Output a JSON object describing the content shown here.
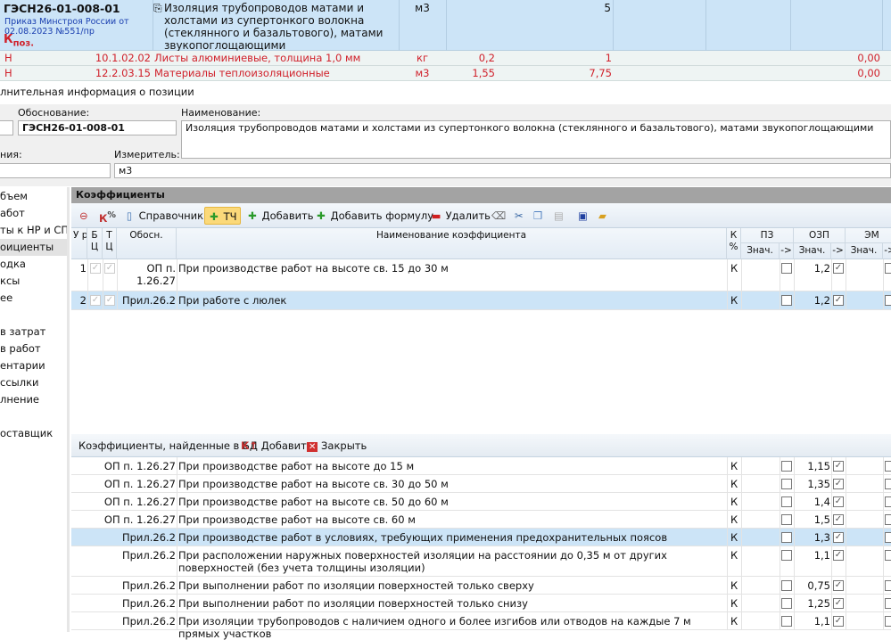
{
  "position": {
    "code": "ГЭСН26-01-008-01",
    "order": "Приказ Минстроя России от 02.08.2023 №551/пр",
    "kpoz_main": "К",
    "kpoz_sub": "поз.",
    "name": "Изоляция трубопроводов матами и холстами из супертонкого волокна (стеклянного и базальтового), матами звукопоглощающими",
    "unit": "м3",
    "qty": "5"
  },
  "resources": [
    {
      "type": "Н",
      "code": "10.1.02.02",
      "name": "Листы алюминиевые, толщина 1,0 мм",
      "unit": "кг",
      "norm": "0,2",
      "qty": "1",
      "sum": "0,00"
    },
    {
      "type": "Н",
      "code": "12.2.03.15",
      "name": "Материалы теплоизоляционные",
      "unit": "м3",
      "norm": "1,55",
      "qty": "7,75",
      "sum": "0,00"
    }
  ],
  "info_title": "лнительная информация о позиции",
  "form": {
    "basis_label": "Обоснование:",
    "basis_value": "ГЭСН26-01-008-01",
    "name_label": "Наименование:",
    "name_value": "Изоляция трубопроводов матами и холстами из супертонкого волокна (стеклянного и базальтового), матами звукопоглощающими",
    "left_label": "ния:",
    "unit_label": "Измеритель:",
    "unit_value": "м3"
  },
  "sidebar": [
    "бъем",
    "абот",
    "ты к НР и СП",
    "оициенты",
    "одка",
    "ксы",
    "ее",
    "в затрат",
    "в работ",
    "ентарии",
    "ссылки",
    "лнение",
    "оставщик"
  ],
  "sidebar_selected": 3,
  "panel_title": "Коэффициенты",
  "toolbar": {
    "k_label": "К",
    "reference": "Справочник",
    "tch": "ТЧ",
    "add": "Добавить",
    "add_formula": "Добавить формулу",
    "delete": "Удалить"
  },
  "columns": {
    "ur": "У р",
    "bc": "Б Ц",
    "tc": "Т Ц",
    "basis": "Обосн.",
    "name": "Наименование коэффициента",
    "kp": "К %",
    "pz": "ПЗ",
    "ozp": "ОЗП",
    "em": "ЭМ",
    "val": "Знач.",
    "arrow": "->"
  },
  "coefs": [
    {
      "n": "1",
      "basis": "ОП п. 1.26.27",
      "name": "При производстве работ на высоте св. 15 до 30 м",
      "k": "К",
      "ozp": "1,2"
    },
    {
      "n": "2",
      "basis": "Прил.26.2",
      "name": "При работе с люлек",
      "k": "К",
      "ozp": "1,2"
    }
  ],
  "found": {
    "title": "Коэффициенты, найденные в БД",
    "add": "Добавить",
    "close": "Закрыть",
    "rows": [
      {
        "basis": "ОП п. 1.26.27",
        "name": "При производстве работ на высоте до 15 м",
        "k": "К",
        "ozp": "1,15"
      },
      {
        "basis": "ОП п. 1.26.27",
        "name": "При производстве работ на высоте св. 30 до 50 м",
        "k": "К",
        "ozp": "1,35"
      },
      {
        "basis": "ОП п. 1.26.27",
        "name": "При производстве работ на высоте св. 50 до 60 м",
        "k": "К",
        "ozp": "1,4"
      },
      {
        "basis": "ОП п. 1.26.27",
        "name": "При производстве работ на высоте св. 60 м",
        "k": "К",
        "ozp": "1,5"
      },
      {
        "basis": "Прил.26.2",
        "name": "При производстве работ в условиях, требующих применения предохранительных поясов",
        "k": "К",
        "ozp": "1,3"
      },
      {
        "basis": "Прил.26.2",
        "name": "При расположении наружных поверхностей изоляции на расстоянии до 0,35 м от других поверхностей (без учета толщины изоляции)",
        "k": "К",
        "ozp": "1,1"
      },
      {
        "basis": "Прил.26.2",
        "name": "При выполнении работ по изоляции поверхностей только сверху",
        "k": "К",
        "ozp": "0,75"
      },
      {
        "basis": "Прил.26.2",
        "name": "При выполнении работ по изоляции поверхностей только снизу",
        "k": "К",
        "ozp": "1,25"
      },
      {
        "basis": "Прил.26.2",
        "name": "При изоляции трубопроводов с наличием одного и более изгибов или отводов на каждые 7 м прямых участков",
        "k": "К",
        "ozp": "1,1"
      }
    ]
  },
  "selected_coef_row": 2,
  "selected_found_row": 5
}
